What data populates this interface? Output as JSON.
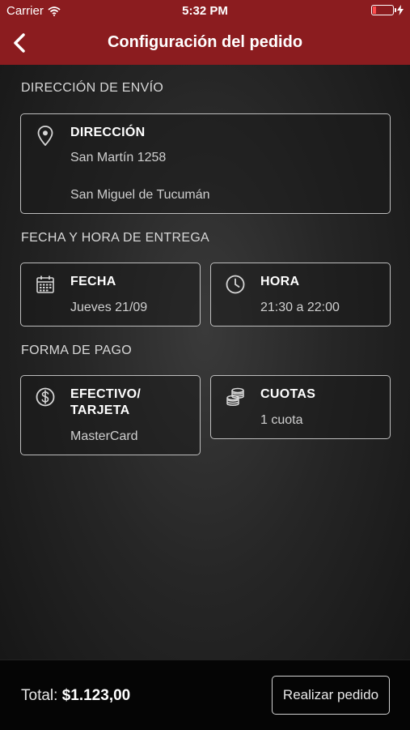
{
  "status_bar": {
    "carrier": "Carrier",
    "time": "5:32 PM"
  },
  "nav": {
    "title": "Configuración del pedido"
  },
  "shipping": {
    "section_label": "DIRECCIÓN DE ENVÍO",
    "card_title": "DIRECCIÓN",
    "line1": "San Martín  1258",
    "line2": "San Miguel de Tucumán"
  },
  "delivery": {
    "section_label": "FECHA Y HORA DE ENTREGA",
    "date_title": "FECHA",
    "date_value": "Jueves 21/09",
    "time_title": "HORA",
    "time_value": "21:30 a 22:00"
  },
  "payment": {
    "section_label": "FORMA DE PAGO",
    "method_title_line1": "EFECTIVO/",
    "method_title_line2": "TARJETA",
    "method_value": "MasterCard",
    "installments_title": "CUOTAS",
    "installments_value": "1 cuota"
  },
  "footer": {
    "total_label": "Total:",
    "total_value": "$1.123,00",
    "order_button": "Realizar pedido"
  },
  "colors": {
    "brand_red": "#8b1c1f",
    "background": "#262626"
  },
  "icons": [
    "back-chevron-icon",
    "wifi-icon",
    "charging-icon",
    "location-pin-icon",
    "calendar-icon",
    "clock-icon",
    "dollar-circle-icon",
    "coins-icon"
  ]
}
